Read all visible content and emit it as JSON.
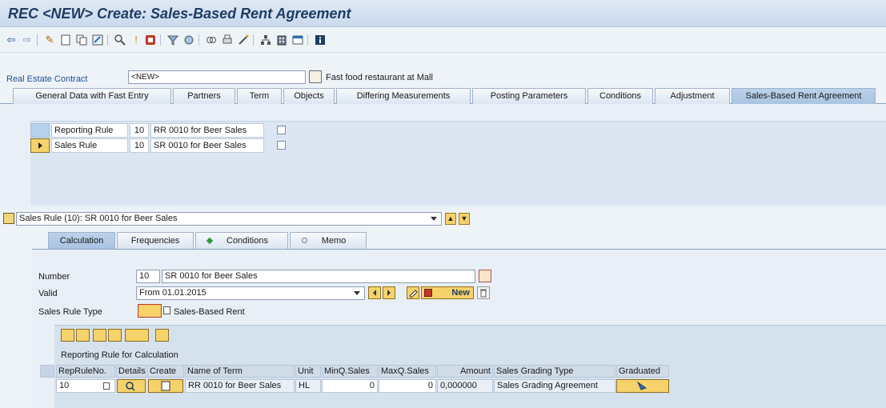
{
  "window": {
    "title": "REC <NEW> Create: Sales-Based Rent Agreement"
  },
  "contract": {
    "label": "Real Estate Contract",
    "value": "<NEW>",
    "description": "Fast food restaurant at Mall"
  },
  "tabs": [
    {
      "label": "General Data with Fast Entry"
    },
    {
      "label": "Partners"
    },
    {
      "label": "Term"
    },
    {
      "label": "Objects"
    },
    {
      "label": "Differing Measurements"
    },
    {
      "label": "Posting Parameters"
    },
    {
      "label": "Conditions"
    },
    {
      "label": "Adjustment"
    },
    {
      "label": "Sales-Based Rent Agreement",
      "active": true
    }
  ],
  "rules_table": {
    "rows": [
      {
        "type": "Reporting Rule",
        "number": "10",
        "name": "RR 0010 for Beer Sales",
        "selected": false
      },
      {
        "type": "Sales Rule",
        "number": "10",
        "name": "SR 0010 for Beer Sales",
        "selected": true
      }
    ]
  },
  "rule_selector": {
    "value": "Sales Rule (10): SR 0010 for Beer Sales"
  },
  "subtabs": [
    {
      "label": "Calculation",
      "active": true
    },
    {
      "label": "Frequencies"
    },
    {
      "label": "Conditions"
    },
    {
      "label": "Memo"
    }
  ],
  "form": {
    "number_label": "Number",
    "number_value": "10",
    "number_text": "SR 0010 for Beer Sales",
    "valid_label": "Valid",
    "valid_value": "From 01.01.2015",
    "new_button": "New",
    "rule_type_label": "Sales Rule Type",
    "rule_type_value": "",
    "rule_type_text": "Sales-Based Rent"
  },
  "calc_table": {
    "title": "Reporting Rule for Calculation",
    "columns": [
      "RepRuleNo.",
      "Details",
      "Create",
      "Name of Term",
      "Unit",
      "MinQ.Sales",
      "MaxQ.Sales",
      "Amount",
      "Sales Grading Type",
      "Graduated"
    ],
    "rows": [
      {
        "rep_rule_no": "10",
        "name_of_term": "RR 0010 for Beer Sales",
        "unit": "HL",
        "min_q_sales": "0",
        "max_q_sales": "0",
        "amount": "0,000000",
        "sales_grading_type": "Sales Grading Agreement"
      }
    ]
  },
  "colors": {
    "title": "#1f3c63",
    "accent_yellow": "#f6d26a",
    "selected_tab": "#a9c3e1",
    "label_blue": "#1d4f91"
  }
}
